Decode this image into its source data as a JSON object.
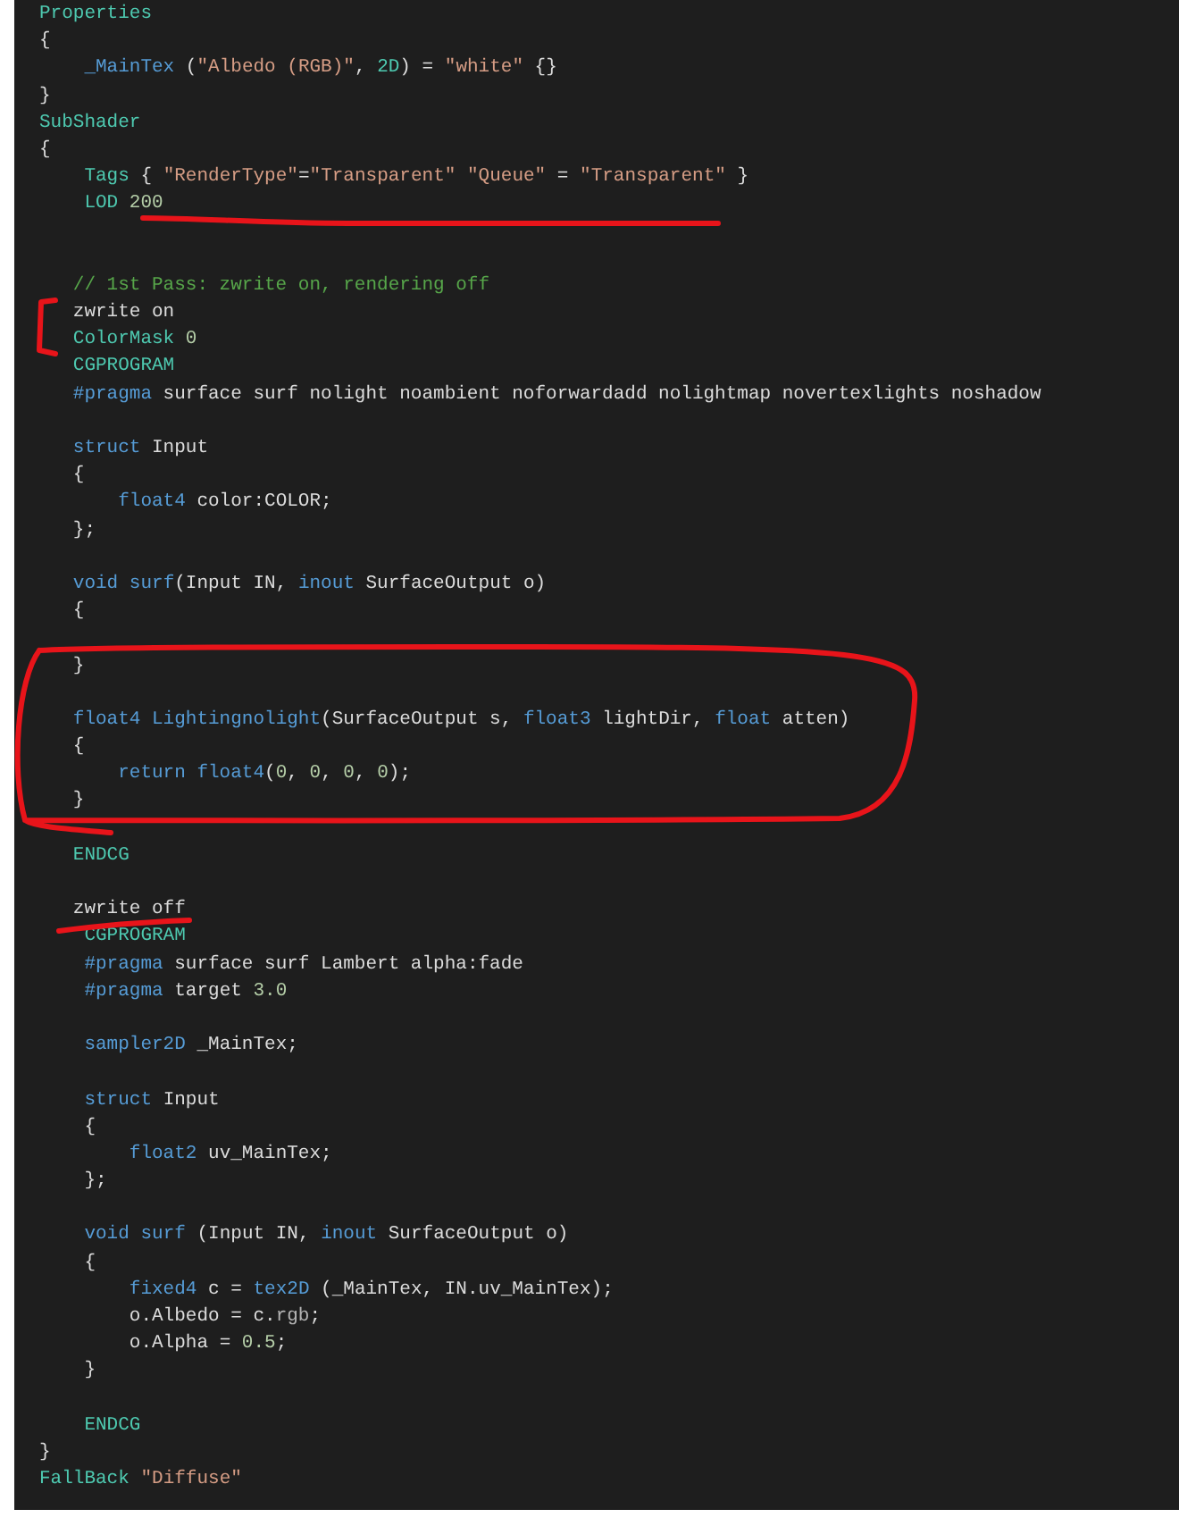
{
  "editor": {
    "lines": [
      {
        "kind": "code",
        "tokens": [
          {
            "kind": "sec",
            "text": "Properties"
          }
        ]
      },
      {
        "kind": "code",
        "tokens": [
          {
            "kind": "txt",
            "text": "{"
          }
        ]
      },
      {
        "kind": "code",
        "tokens": [
          {
            "kind": "kw",
            "text": "    _MainTex"
          },
          {
            "kind": "txt",
            "text": " ("
          },
          {
            "kind": "str",
            "text": "\"Albedo (RGB)\""
          },
          {
            "kind": "txt",
            "text": ", "
          },
          {
            "kind": "sec",
            "text": "2D"
          },
          {
            "kind": "txt",
            "text": ") = "
          },
          {
            "kind": "str",
            "text": "\"white\""
          },
          {
            "kind": "txt",
            "text": " {}"
          }
        ]
      },
      {
        "kind": "code",
        "tokens": [
          {
            "kind": "txt",
            "text": "}"
          }
        ]
      },
      {
        "kind": "code",
        "tokens": [
          {
            "kind": "sec",
            "text": "SubShader"
          }
        ]
      },
      {
        "kind": "code",
        "tokens": [
          {
            "kind": "txt",
            "text": "{"
          }
        ]
      },
      {
        "kind": "code",
        "tokens": [
          {
            "kind": "sec",
            "text": "    Tags"
          },
          {
            "kind": "txt",
            "text": " { "
          },
          {
            "kind": "str",
            "text": "\"RenderType\""
          },
          {
            "kind": "txt",
            "text": "="
          },
          {
            "kind": "str",
            "text": "\"Transparent\""
          },
          {
            "kind": "str",
            "text": " \"Queue\""
          },
          {
            "kind": "txt",
            "text": " = "
          },
          {
            "kind": "str",
            "text": "\"Transparent\""
          },
          {
            "kind": "txt",
            "text": " }"
          }
        ]
      },
      {
        "kind": "code",
        "tokens": [
          {
            "kind": "sec",
            "text": "    LOD"
          },
          {
            "kind": "num",
            "text": " 200"
          }
        ]
      },
      {
        "kind": "blank"
      },
      {
        "kind": "blank"
      },
      {
        "kind": "code",
        "tokens": [
          {
            "kind": "com",
            "text": "   // 1st Pass: zwrite on, rendering off"
          }
        ]
      },
      {
        "kind": "code",
        "tokens": [
          {
            "kind": "txt",
            "text": "   zwrite on"
          }
        ]
      },
      {
        "kind": "code",
        "tokens": [
          {
            "kind": "sec",
            "text": "   ColorMask"
          },
          {
            "kind": "num",
            "text": " 0"
          }
        ]
      },
      {
        "kind": "code",
        "tokens": [
          {
            "kind": "sec",
            "text": "   CGPROGRAM"
          }
        ]
      },
      {
        "kind": "code",
        "tokens": [
          {
            "kind": "kw",
            "text": "   #pragma"
          },
          {
            "kind": "txt",
            "text": " surface surf nolight noambient noforwardadd nolightmap novertexlights noshadow"
          }
        ]
      },
      {
        "kind": "blank"
      },
      {
        "kind": "code",
        "tokens": [
          {
            "kind": "kw",
            "text": "   struct"
          },
          {
            "kind": "txt",
            "text": " Input"
          }
        ]
      },
      {
        "kind": "code",
        "tokens": [
          {
            "kind": "txt",
            "text": "   {"
          }
        ]
      },
      {
        "kind": "code",
        "tokens": [
          {
            "kind": "kw",
            "text": "       float4"
          },
          {
            "kind": "txt",
            "text": " color:COLOR;"
          }
        ]
      },
      {
        "kind": "code",
        "tokens": [
          {
            "kind": "txt",
            "text": "   };"
          }
        ]
      },
      {
        "kind": "blank"
      },
      {
        "kind": "code",
        "tokens": [
          {
            "kind": "kw",
            "text": "   void"
          },
          {
            "kind": "kw",
            "text": " surf"
          },
          {
            "kind": "txt",
            "text": "(Input IN, "
          },
          {
            "kind": "kw",
            "text": "inout"
          },
          {
            "kind": "txt",
            "text": " SurfaceOutput o)"
          }
        ]
      },
      {
        "kind": "code",
        "tokens": [
          {
            "kind": "txt",
            "text": "   {"
          }
        ]
      },
      {
        "kind": "blank"
      },
      {
        "kind": "code",
        "tokens": [
          {
            "kind": "txt",
            "text": "   }"
          }
        ]
      },
      {
        "kind": "blank"
      },
      {
        "kind": "code",
        "tokens": [
          {
            "kind": "kw",
            "text": "   float4"
          },
          {
            "kind": "kw",
            "text": " Lightingnolight"
          },
          {
            "kind": "txt",
            "text": "(SurfaceOutput s, "
          },
          {
            "kind": "kw",
            "text": "float3"
          },
          {
            "kind": "txt",
            "text": " lightDir, "
          },
          {
            "kind": "kw",
            "text": "float"
          },
          {
            "kind": "txt",
            "text": " atten)"
          }
        ]
      },
      {
        "kind": "code",
        "tokens": [
          {
            "kind": "txt",
            "text": "   {"
          }
        ]
      },
      {
        "kind": "code",
        "tokens": [
          {
            "kind": "kw",
            "text": "       return"
          },
          {
            "kind": "kw",
            "text": " float4"
          },
          {
            "kind": "txt",
            "text": "("
          },
          {
            "kind": "num",
            "text": "0"
          },
          {
            "kind": "txt",
            "text": ", "
          },
          {
            "kind": "num",
            "text": "0"
          },
          {
            "kind": "txt",
            "text": ", "
          },
          {
            "kind": "num",
            "text": "0"
          },
          {
            "kind": "txt",
            "text": ", "
          },
          {
            "kind": "num",
            "text": "0"
          },
          {
            "kind": "txt",
            "text": ");"
          }
        ]
      },
      {
        "kind": "code",
        "tokens": [
          {
            "kind": "txt",
            "text": "   }"
          }
        ]
      },
      {
        "kind": "blank"
      },
      {
        "kind": "code",
        "tokens": [
          {
            "kind": "sec",
            "text": "   ENDCG"
          }
        ]
      },
      {
        "kind": "blank"
      },
      {
        "kind": "code",
        "tokens": [
          {
            "kind": "txt",
            "text": "   zwrite off"
          }
        ]
      },
      {
        "kind": "code",
        "tokens": [
          {
            "kind": "sec",
            "text": "    CGPROGRAM"
          }
        ]
      },
      {
        "kind": "code",
        "tokens": [
          {
            "kind": "kw",
            "text": "    #pragma"
          },
          {
            "kind": "txt",
            "text": " surface surf Lambert alpha:fade"
          }
        ]
      },
      {
        "kind": "code",
        "tokens": [
          {
            "kind": "kw",
            "text": "    #pragma"
          },
          {
            "kind": "txt",
            "text": " target "
          },
          {
            "kind": "num",
            "text": "3.0"
          }
        ]
      },
      {
        "kind": "blank"
      },
      {
        "kind": "code",
        "tokens": [
          {
            "kind": "kw",
            "text": "    sampler2D"
          },
          {
            "kind": "txt",
            "text": " _MainTex;"
          }
        ]
      },
      {
        "kind": "blank"
      },
      {
        "kind": "code",
        "tokens": [
          {
            "kind": "kw",
            "text": "    struct"
          },
          {
            "kind": "txt",
            "text": " Input"
          }
        ]
      },
      {
        "kind": "code",
        "tokens": [
          {
            "kind": "txt",
            "text": "    {"
          }
        ]
      },
      {
        "kind": "code",
        "tokens": [
          {
            "kind": "kw",
            "text": "        float2"
          },
          {
            "kind": "txt",
            "text": " uv_MainTex;"
          }
        ]
      },
      {
        "kind": "code",
        "tokens": [
          {
            "kind": "txt",
            "text": "    };"
          }
        ]
      },
      {
        "kind": "blank"
      },
      {
        "kind": "code",
        "tokens": [
          {
            "kind": "kw",
            "text": "    void"
          },
          {
            "kind": "kw",
            "text": " surf"
          },
          {
            "kind": "txt",
            "text": " (Input IN, "
          },
          {
            "kind": "kw",
            "text": "inout"
          },
          {
            "kind": "txt",
            "text": " SurfaceOutput o)"
          }
        ]
      },
      {
        "kind": "code",
        "tokens": [
          {
            "kind": "txt",
            "text": "    {"
          }
        ]
      },
      {
        "kind": "code",
        "tokens": [
          {
            "kind": "kw",
            "text": "        fixed4"
          },
          {
            "kind": "txt",
            "text": " c = "
          },
          {
            "kind": "kw",
            "text": "tex2D"
          },
          {
            "kind": "txt",
            "text": " (_MainTex, IN.uv_MainTex);"
          }
        ]
      },
      {
        "kind": "code",
        "tokens": [
          {
            "kind": "txt",
            "text": "        o.Albedo = c."
          },
          {
            "kind": "mem",
            "text": "rgb"
          },
          {
            "kind": "txt",
            "text": ";"
          }
        ]
      },
      {
        "kind": "code",
        "tokens": [
          {
            "kind": "txt",
            "text": "        o.Alpha = "
          },
          {
            "kind": "num",
            "text": "0.5"
          },
          {
            "kind": "txt",
            "text": ";"
          }
        ]
      },
      {
        "kind": "code",
        "tokens": [
          {
            "kind": "txt",
            "text": "    }"
          }
        ]
      },
      {
        "kind": "blank"
      },
      {
        "kind": "code",
        "tokens": [
          {
            "kind": "sec",
            "text": "    ENDCG"
          }
        ]
      },
      {
        "kind": "code",
        "tokens": [
          {
            "kind": "txt",
            "text": "}"
          }
        ]
      },
      {
        "kind": "code",
        "tokens": [
          {
            "kind": "sec",
            "text": "FallBack"
          },
          {
            "kind": "str",
            "text": " \"Diffuse\""
          }
        ]
      }
    ]
  },
  "annotations": [
    {
      "kind": "underline"
    },
    {
      "kind": "bracket"
    },
    {
      "kind": "loop"
    },
    {
      "kind": "short-underline"
    }
  ]
}
